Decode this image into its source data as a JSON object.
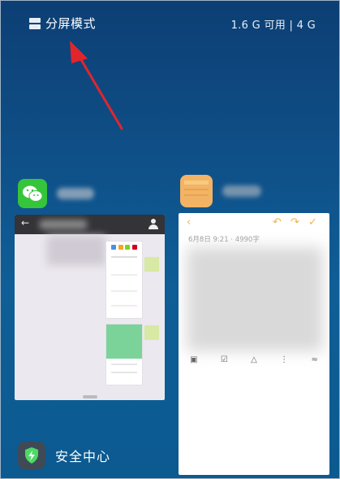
{
  "top_bar": {
    "split_label": "分屏模式",
    "memory_text": "1.6 G 可用 | 4 G"
  },
  "apps": [
    {
      "id": "wechat",
      "icon": "wechat-icon",
      "color": "#36c53a"
    },
    {
      "id": "notes",
      "icon": "notes-icon",
      "color": "#f3b365"
    }
  ],
  "notes_card": {
    "date_line": "6月8日 9:21 · 4990字",
    "toolbar_icons": [
      "back-icon",
      "undo-icon",
      "redo-icon",
      "check-icon"
    ]
  },
  "security_center": {
    "label": "安全中心",
    "icon": "shield-icon"
  },
  "colors": {
    "arrow": "#e0262c",
    "note_accent": "#f0b54a"
  }
}
